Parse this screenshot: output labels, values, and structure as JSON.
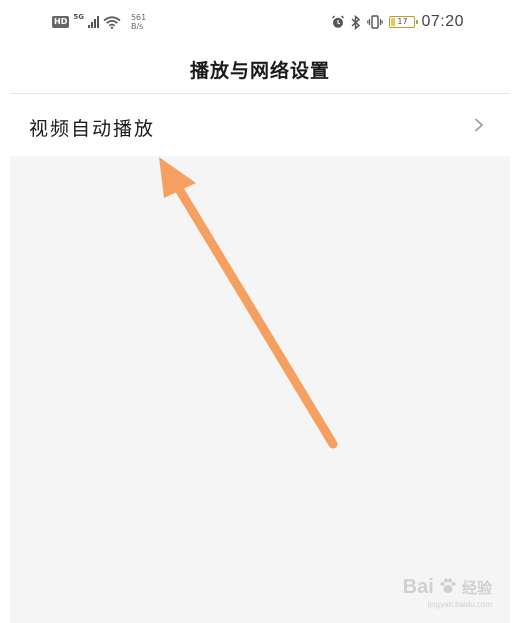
{
  "status_bar": {
    "hd_label": "HD",
    "network_type": "5G",
    "speed_value": "561",
    "speed_unit": "B/s",
    "battery_level": "17",
    "battery_fraction": 0.17,
    "time": "07:20",
    "icons": [
      "hd-icon",
      "signal-icon",
      "wifi-icon",
      "alarm-icon",
      "bluetooth-icon",
      "vibrate-icon",
      "battery-icon"
    ]
  },
  "header": {
    "title": "播放与网络设置"
  },
  "settings": {
    "items": [
      {
        "label": "视频自动播放",
        "icon": "chevron-right-icon"
      }
    ]
  },
  "annotation": {
    "color": "#f5a060"
  },
  "watermark": {
    "brand": "Bai",
    "brand_suffix": "经验",
    "url": "jingyan.baidu.com"
  },
  "colors": {
    "background": "#ffffff",
    "content_background": "#f5f5f5",
    "divider": "#e4e4e4",
    "text_primary": "#1a1a1a",
    "battery": "#e8c850",
    "arrow": "#f5a060"
  }
}
